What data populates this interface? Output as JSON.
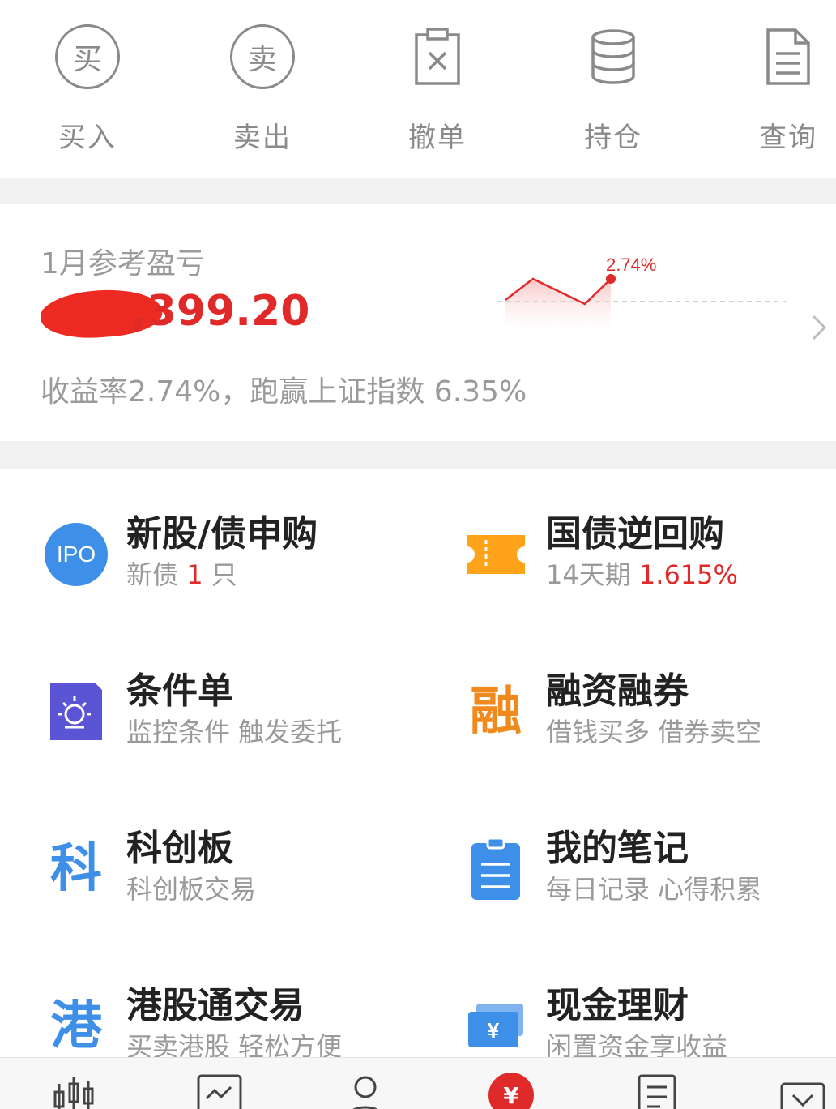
{
  "quick_actions": [
    {
      "label": "买入",
      "icon_char": "买",
      "icon": "buy-icon"
    },
    {
      "label": "卖出",
      "icon_char": "卖",
      "icon": "sell-icon"
    },
    {
      "label": "撤单",
      "icon": "cancel-order-icon"
    },
    {
      "label": "持仓",
      "icon": "position-icon"
    },
    {
      "label": "查询",
      "icon": "query-icon"
    }
  ],
  "profit": {
    "title": "1月参考盈亏",
    "amount": ",399.20",
    "summary": "收益率2.74%，跑赢上证指数 6.35%",
    "chart_label": "2.74%"
  },
  "features": [
    {
      "title": "新股/债申购",
      "sub_prefix": "新债 ",
      "sub_highlight": "1",
      "sub_suffix": " 只",
      "icon": "ipo-icon",
      "icon_text": "IPO"
    },
    {
      "title": "国债逆回购",
      "sub_prefix": "14天期 ",
      "sub_highlight": "1.615%",
      "sub_suffix": "",
      "icon": "ticket-icon"
    },
    {
      "title": "条件单",
      "sub": "监控条件 触发委托",
      "icon": "condition-order-icon"
    },
    {
      "title": "融资融券",
      "sub": "借钱买多 借券卖空",
      "icon": "margin-icon",
      "icon_text": "融"
    },
    {
      "title": "科创板",
      "sub": "科创板交易",
      "icon": "star-market-icon",
      "icon_text": "科"
    },
    {
      "title": "我的笔记",
      "sub": "每日记录 心得积累",
      "icon": "notes-icon"
    },
    {
      "title": "港股通交易",
      "sub": "买卖港股 轻松方便",
      "icon": "hk-connect-icon",
      "icon_text": "港"
    },
    {
      "title": "现金理财",
      "sub": "闲置资金享收益",
      "icon": "cash-management-icon",
      "icon_text": "¥"
    }
  ],
  "tabbar": {
    "active_icon_text": "¥"
  },
  "colors": {
    "accent_red": "#e02a2a",
    "icon_gray": "#8a8a8a",
    "ipo_blue": "#3d8fe8",
    "ticket_orange": "#ffa31a",
    "condition_purple": "#5b55d6",
    "margin_orange": "#f08a1e",
    "star_blue": "#3d8fe8"
  }
}
